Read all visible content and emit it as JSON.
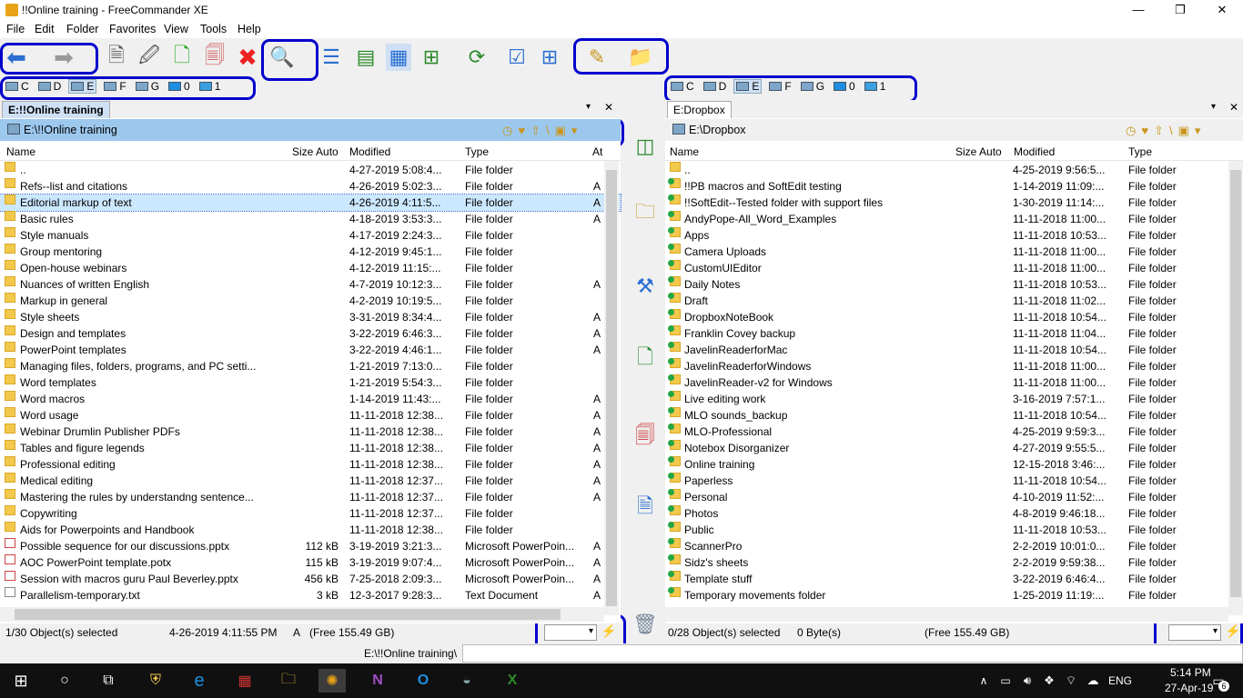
{
  "window": {
    "title": "!!Online training - FreeCommander XE",
    "minimize": "—",
    "maximize": "❐",
    "close": "✕"
  },
  "menu": [
    "File",
    "Edit",
    "Folder",
    "Favorites",
    "View",
    "Tools",
    "Help"
  ],
  "left": {
    "drives": [
      "C",
      "D",
      "E",
      "F",
      "G",
      "0",
      "1"
    ],
    "tab": "E:!!Online training",
    "path": "E:\\!!Online training",
    "columns": {
      "name": "Name",
      "size": "Size Auto",
      "modified": "Modified",
      "type": "Type",
      "attr": "At"
    },
    "rows": [
      {
        "name": "..",
        "size": "",
        "modified": "4-27-2019 5:08:4...",
        "type": "File folder",
        "attr": ""
      },
      {
        "name": "Refs--list and citations",
        "size": "",
        "modified": "4-26-2019 5:02:3...",
        "type": "File folder",
        "attr": "A"
      },
      {
        "name": "Editorial markup of text",
        "size": "",
        "modified": "4-26-2019 4:11:5...",
        "type": "File folder",
        "attr": "A"
      },
      {
        "name": "Basic rules",
        "size": "",
        "modified": "4-18-2019 3:53:3...",
        "type": "File folder",
        "attr": "A"
      },
      {
        "name": "Style manuals",
        "size": "",
        "modified": "4-17-2019 2:24:3...",
        "type": "File folder",
        "attr": ""
      },
      {
        "name": "Group mentoring",
        "size": "",
        "modified": "4-12-2019 9:45:1...",
        "type": "File folder",
        "attr": ""
      },
      {
        "name": "Open-house webinars",
        "size": "",
        "modified": "4-12-2019 11:15:...",
        "type": "File folder",
        "attr": ""
      },
      {
        "name": "Nuances of written English",
        "size": "",
        "modified": "4-7-2019 10:12:3...",
        "type": "File folder",
        "attr": "A"
      },
      {
        "name": "Markup in general",
        "size": "",
        "modified": "4-2-2019 10:19:5...",
        "type": "File folder",
        "attr": ""
      },
      {
        "name": "Style sheets",
        "size": "",
        "modified": "3-31-2019 8:34:4...",
        "type": "File folder",
        "attr": "A"
      },
      {
        "name": "Design and templates",
        "size": "",
        "modified": "3-22-2019 6:46:3...",
        "type": "File folder",
        "attr": "A"
      },
      {
        "name": "PowerPoint templates",
        "size": "",
        "modified": "3-22-2019 4:46:1...",
        "type": "File folder",
        "attr": "A"
      },
      {
        "name": "Managing files, folders, programs, and PC setti...",
        "size": "",
        "modified": "1-21-2019 7:13:0...",
        "type": "File folder",
        "attr": ""
      },
      {
        "name": "Word templates",
        "size": "",
        "modified": "1-21-2019 5:54:3...",
        "type": "File folder",
        "attr": ""
      },
      {
        "name": "Word macros",
        "size": "",
        "modified": "1-14-2019 11:43:...",
        "type": "File folder",
        "attr": "A"
      },
      {
        "name": "Word usage",
        "size": "",
        "modified": "11-11-2018 12:38...",
        "type": "File folder",
        "attr": "A"
      },
      {
        "name": "Webinar Drumlin Publisher PDFs",
        "size": "",
        "modified": "11-11-2018 12:38...",
        "type": "File folder",
        "attr": "A"
      },
      {
        "name": "Tables and figure legends",
        "size": "",
        "modified": "11-11-2018 12:38...",
        "type": "File folder",
        "attr": "A"
      },
      {
        "name": "Professional editing",
        "size": "",
        "modified": "11-11-2018 12:38...",
        "type": "File folder",
        "attr": "A"
      },
      {
        "name": "Medical editing",
        "size": "",
        "modified": "11-11-2018 12:37...",
        "type": "File folder",
        "attr": "A"
      },
      {
        "name": "Mastering the rules by understandng sentence...",
        "size": "",
        "modified": "11-11-2018 12:37...",
        "type": "File folder",
        "attr": "A"
      },
      {
        "name": "Copywriting",
        "size": "",
        "modified": "11-11-2018 12:37...",
        "type": "File folder",
        "attr": ""
      },
      {
        "name": "Aids for Powerpoints and Handbook",
        "size": "",
        "modified": "11-11-2018 12:38...",
        "type": "File folder",
        "attr": ""
      },
      {
        "name": "Possible sequence for our discussions.pptx",
        "size": "112 kB",
        "modified": "3-19-2019 3:21:3...",
        "type": "Microsoft PowerPoin...",
        "attr": "A",
        "kind": "ppt"
      },
      {
        "name": "AOC PowerPoint template.potx",
        "size": "115 kB",
        "modified": "3-19-2019 9:07:4...",
        "type": "Microsoft PowerPoin...",
        "attr": "A",
        "kind": "ppt"
      },
      {
        "name": "Session with macros guru Paul Beverley.pptx",
        "size": "456 kB",
        "modified": "7-25-2018 2:09:3...",
        "type": "Microsoft PowerPoin...",
        "attr": "A",
        "kind": "ppt"
      },
      {
        "name": "Parallelism-temporary.txt",
        "size": "3 kB",
        "modified": "12-3-2017 9:28:3...",
        "type": "Text Document",
        "attr": "A",
        "kind": "txt"
      }
    ],
    "status": {
      "selected": "1/30 Object(s) selected",
      "date": "4-26-2019 4:11:55 PM",
      "attr": "A",
      "free": "(Free 155.49 GB)"
    }
  },
  "right": {
    "drives": [
      "C",
      "D",
      "E",
      "F",
      "G",
      "0",
      "1"
    ],
    "tab": "E:Dropbox",
    "path": "E:\\Dropbox",
    "columns": {
      "name": "Name",
      "size": "Size Auto",
      "modified": "Modified",
      "type": "Type"
    },
    "rows": [
      {
        "name": "..",
        "modified": "4-25-2019 9:56:5...",
        "type": "File folder"
      },
      {
        "name": "!!PB macros and SoftEdit testing",
        "modified": "1-14-2019 11:09:...",
        "type": "File folder"
      },
      {
        "name": "!!SoftEdit--Tested folder with support files",
        "modified": "1-30-2019 11:14:...",
        "type": "File folder"
      },
      {
        "name": "AndyPope-All_Word_Examples",
        "modified": "11-11-2018 11:00...",
        "type": "File folder"
      },
      {
        "name": "Apps",
        "modified": "11-11-2018 10:53...",
        "type": "File folder"
      },
      {
        "name": "Camera Uploads",
        "modified": "11-11-2018 11:00...",
        "type": "File folder"
      },
      {
        "name": "CustomUIEditor",
        "modified": "11-11-2018 11:00...",
        "type": "File folder"
      },
      {
        "name": "Daily Notes",
        "modified": "11-11-2018 10:53...",
        "type": "File folder"
      },
      {
        "name": "Draft",
        "modified": "11-11-2018 11:02...",
        "type": "File folder"
      },
      {
        "name": "DropboxNoteBook",
        "modified": "11-11-2018 10:54...",
        "type": "File folder"
      },
      {
        "name": "Franklin Covey backup",
        "modified": "11-11-2018 11:04...",
        "type": "File folder"
      },
      {
        "name": "JavelinReaderforMac",
        "modified": "11-11-2018 10:54...",
        "type": "File folder"
      },
      {
        "name": "JavelinReaderforWindows",
        "modified": "11-11-2018 11:00...",
        "type": "File folder"
      },
      {
        "name": "JavelinReader-v2 for Windows",
        "modified": "11-11-2018 11:00...",
        "type": "File folder"
      },
      {
        "name": "Live editing work",
        "modified": "3-16-2019 7:57:1...",
        "type": "File folder"
      },
      {
        "name": "MLO sounds_backup",
        "modified": "11-11-2018 10:54...",
        "type": "File folder"
      },
      {
        "name": "MLO-Professional",
        "modified": "4-25-2019 9:59:3...",
        "type": "File folder"
      },
      {
        "name": "Notebox Disorganizer",
        "modified": "4-27-2019 9:55:5...",
        "type": "File folder"
      },
      {
        "name": "Online training",
        "modified": "12-15-2018 3:46:...",
        "type": "File folder"
      },
      {
        "name": "Paperless",
        "modified": "11-11-2018 10:54...",
        "type": "File folder"
      },
      {
        "name": "Personal",
        "modified": "4-10-2019 11:52:...",
        "type": "File folder"
      },
      {
        "name": "Photos",
        "modified": "4-8-2019 9:46:18...",
        "type": "File folder"
      },
      {
        "name": "Public",
        "modified": "11-11-2018 10:53...",
        "type": "File folder"
      },
      {
        "name": "ScannerPro",
        "modified": "2-2-2019 10:01:0...",
        "type": "File folder"
      },
      {
        "name": "Sidz's sheets",
        "modified": "2-2-2019 9:59:38...",
        "type": "File folder"
      },
      {
        "name": "Template stuff",
        "modified": "3-22-2019 6:46:4...",
        "type": "File folder"
      },
      {
        "name": "Temporary movements folder",
        "modified": "1-25-2019 11:19:...",
        "type": "File folder"
      }
    ],
    "status": {
      "selected": "0/28 Object(s) selected",
      "bytes": "0 Byte(s)",
      "free": "(Free 155.49 GB)"
    }
  },
  "cmdline": "E:\\!!Online training\\",
  "taskbar": {
    "time": "5:14 PM",
    "date": "27-Apr-19",
    "lang": "ENG",
    "notif": "6"
  }
}
